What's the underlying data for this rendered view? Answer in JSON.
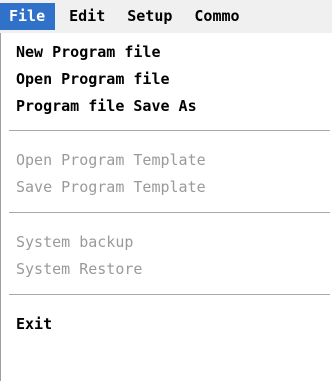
{
  "menubar": {
    "items": [
      "File",
      "Edit",
      "Setup",
      "Commo"
    ],
    "active_index": 0
  },
  "file_menu": {
    "groups": [
      [
        "New Program file",
        "Open Program file",
        "Program file Save As"
      ],
      [
        "Open Program Template",
        "Save Program Template"
      ],
      [
        "System backup",
        "System Restore"
      ],
      [
        "Exit"
      ]
    ],
    "items": {
      "new_program_file": {
        "label": "New Program file",
        "enabled": true
      },
      "open_program_file": {
        "label": "Open Program file",
        "enabled": true
      },
      "program_file_save_as": {
        "label": "Program file Save As",
        "enabled": true
      },
      "open_program_template": {
        "label": "Open Program Template",
        "enabled": false
      },
      "save_program_template": {
        "label": "Save Program Template",
        "enabled": false
      },
      "system_backup": {
        "label": "System backup",
        "enabled": false
      },
      "system_restore": {
        "label": "System Restore",
        "enabled": false
      },
      "exit": {
        "label": "Exit",
        "enabled": true
      }
    }
  },
  "colors": {
    "highlight": "#3071c9",
    "disabled_text": "#9a9a9a",
    "menubar_bg": "#f0f0f0",
    "separator": "#a8a8a8"
  }
}
